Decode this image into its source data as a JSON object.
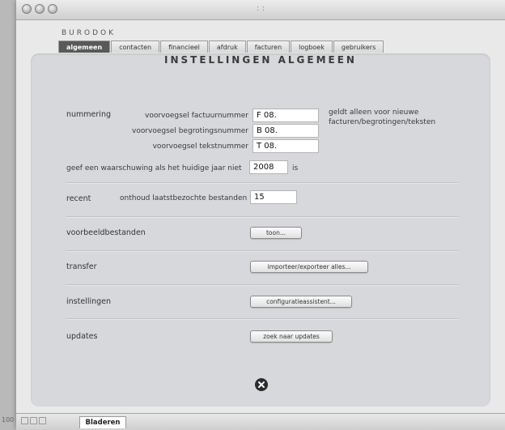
{
  "window": {
    "title": ": :",
    "brand": "BURODOK",
    "tabs": [
      {
        "label": "algemeen",
        "active": true
      },
      {
        "label": "contacten",
        "active": false
      },
      {
        "label": "financieel",
        "active": false
      },
      {
        "label": "afdruk",
        "active": false
      },
      {
        "label": "facturen",
        "active": false
      },
      {
        "label": "logboek",
        "active": false
      },
      {
        "label": "gebruikers",
        "active": false
      }
    ]
  },
  "panel": {
    "heading": "INSTELLINGEN ALGEMEEN",
    "nummering": {
      "section_label": "nummering",
      "factuur_label": "voorvoegsel factuurnummer",
      "factuur_value": "F 08.",
      "begroting_label": "voorvoegsel begrotingsnummer",
      "begroting_value": "B 08.",
      "tekst_label": "voorvoegsel tekstnummer",
      "tekst_value": "T 08.",
      "note_line1": "geldt alleen voor nieuwe",
      "note_line2": "facturen/begrotingen/teksten",
      "warning_label": "geef een waarschuwing als het huidige jaar niet",
      "warning_year": "2008",
      "warning_suffix": "is"
    },
    "recent": {
      "section_label": "recent",
      "label": "onthoud laatstbezochte bestanden",
      "value": "15"
    },
    "voorbeeldbestanden": {
      "section_label": "voorbeeldbestanden",
      "button": "toon..."
    },
    "transfer": {
      "section_label": "transfer",
      "button": "importeer/exporteer alles..."
    },
    "instellingen": {
      "section_label": "instellingen",
      "button": "configuratieassistent..."
    },
    "updates": {
      "section_label": "updates",
      "button": "zoek naar updates"
    },
    "close_icon": "close-x-icon"
  },
  "statusbar": {
    "zoom": "100",
    "mode_label": "Bladeren"
  },
  "colors": {
    "panel_bg": "#d6d8dc",
    "active_tab_bg": "#595959",
    "window_bg": "#e9e9e9"
  }
}
